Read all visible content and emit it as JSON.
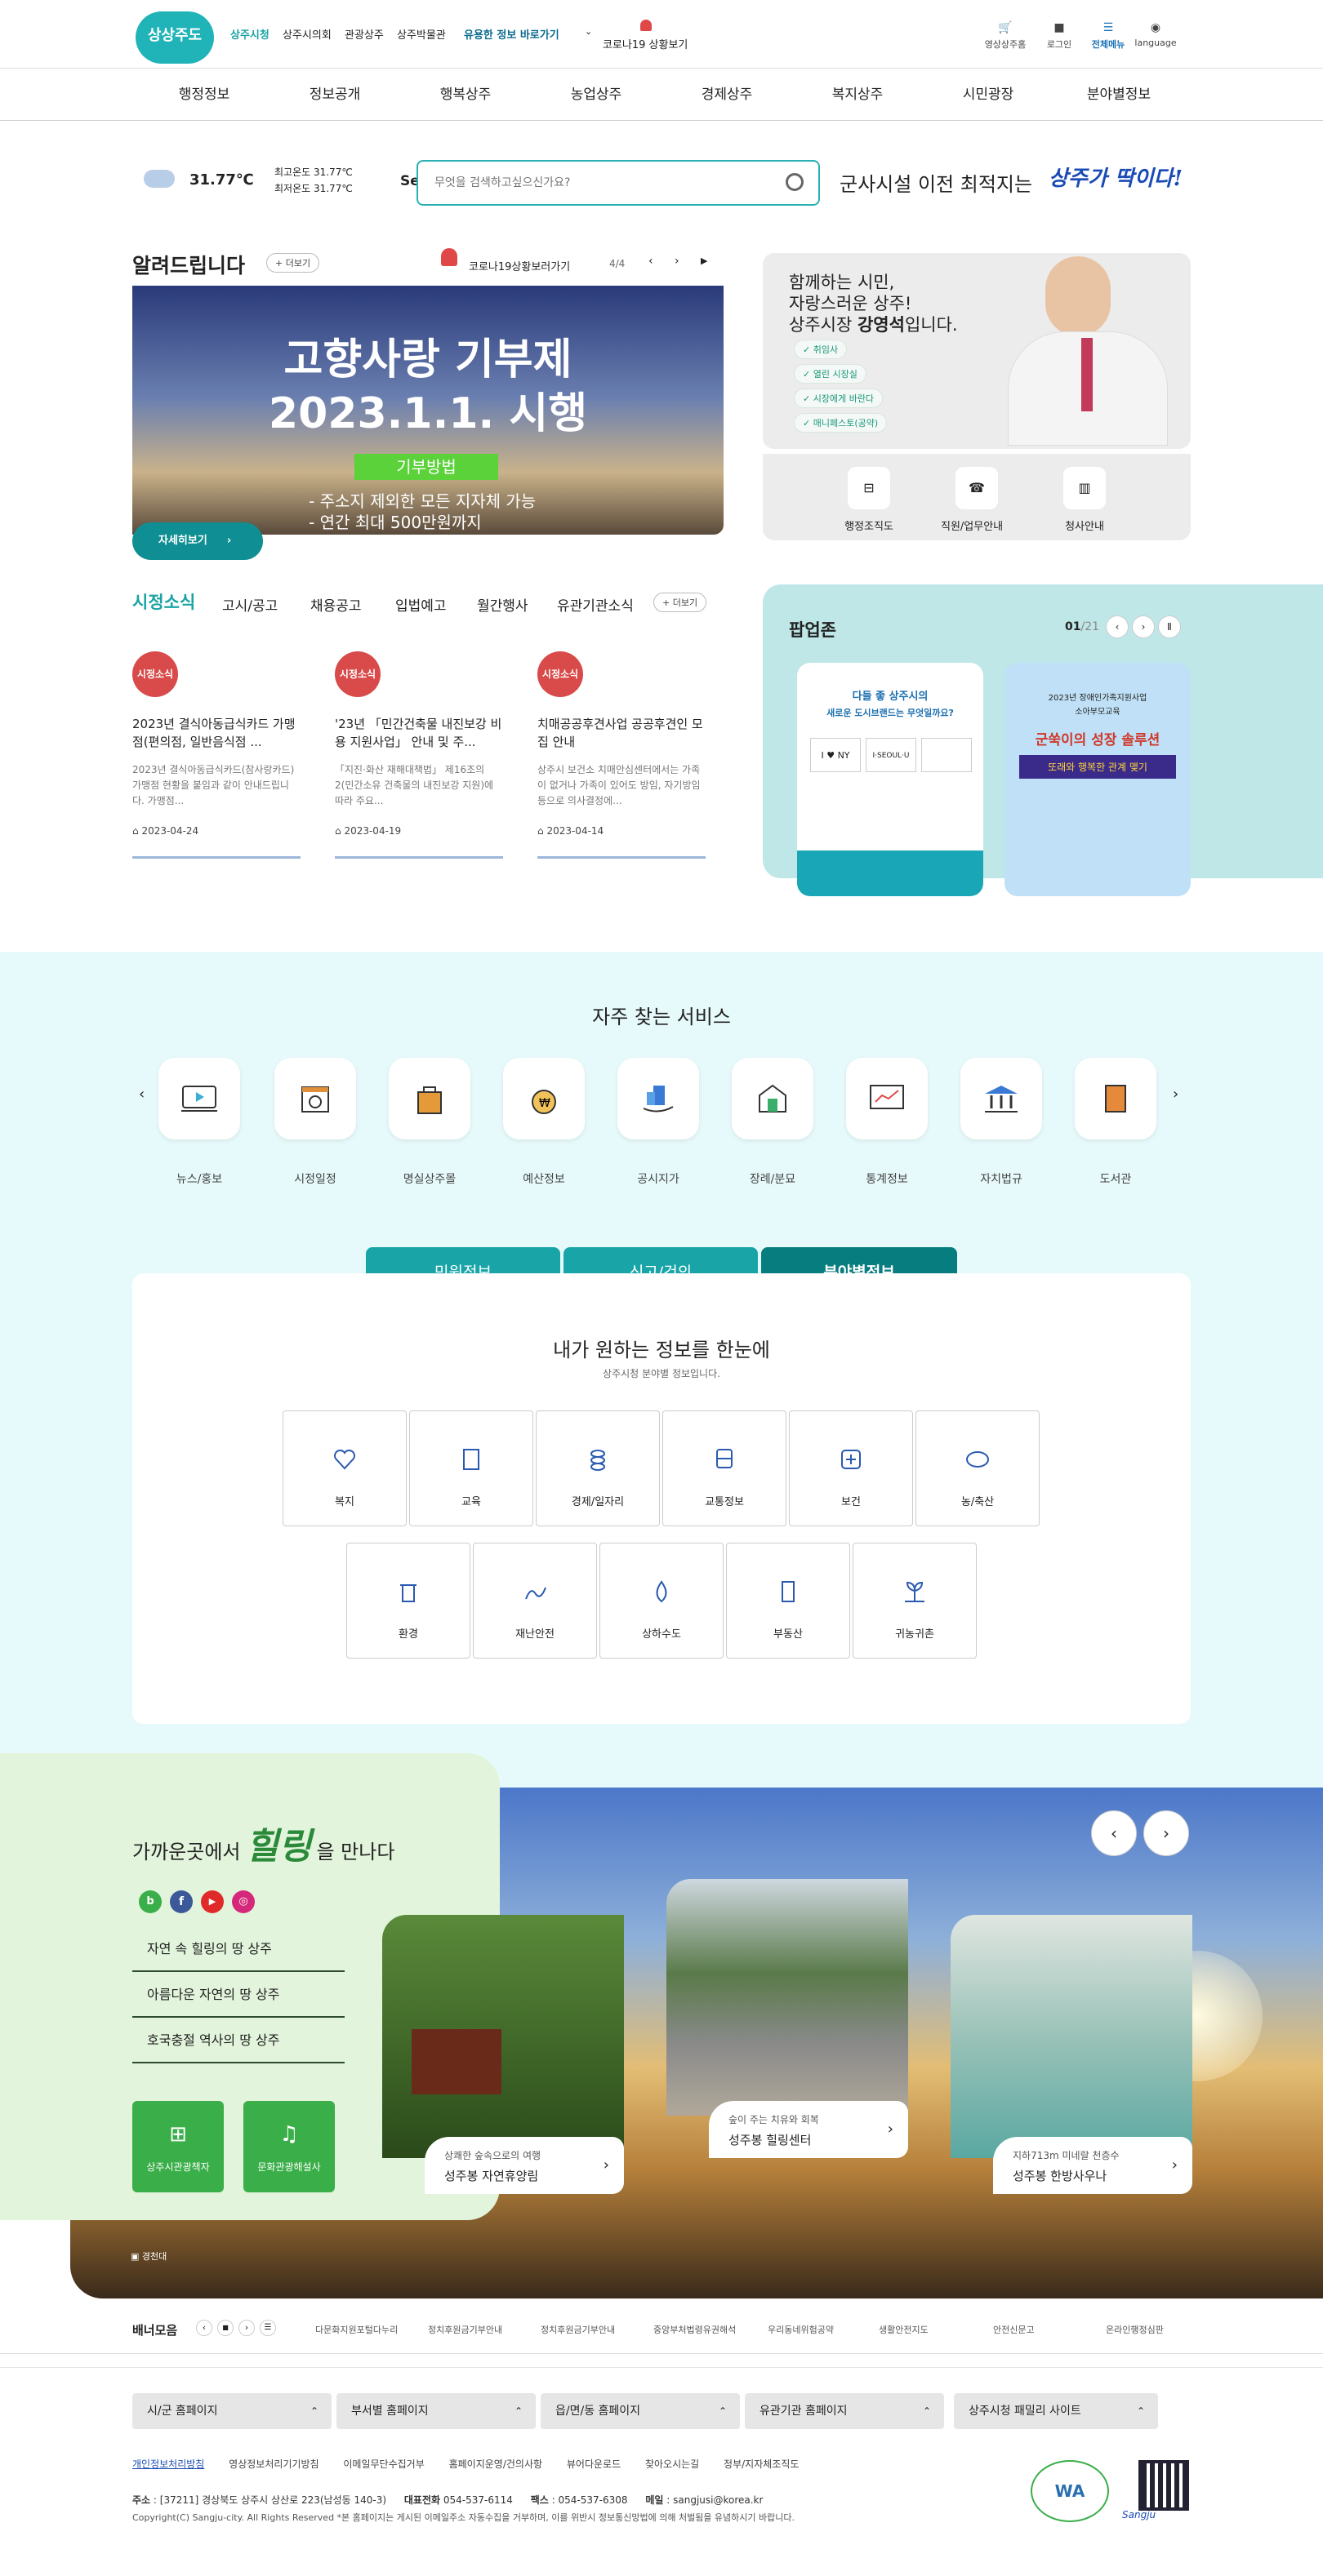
{
  "header": {
    "logo": "상상주도",
    "top_links": [
      "상주시청",
      "상주시의회",
      "관광상주",
      "상주박물관"
    ],
    "info_shortcut": "유용한 정보 바로가기",
    "covid": "코로나19 상황보기",
    "tools": {
      "sitemap": "영상상주홈",
      "login": "로그인",
      "menu": "전체메뉴",
      "lang": "language"
    },
    "gnb": [
      "행정정보",
      "정보공개",
      "행복상주",
      "농업상주",
      "경제상주",
      "복지상주",
      "시민광장",
      "분야별정보"
    ]
  },
  "weather": {
    "temp": "31.77℃",
    "high": "최고온도 31.77℃",
    "low": "최저온도 31.77℃"
  },
  "search": {
    "label": "Search",
    "placeholder": "무엇을 검색하고싶으신가요?"
  },
  "slogan": {
    "text": "군사시설 이전 최적지는",
    "brand": "상주가 딱이다!"
  },
  "notice": {
    "title": "알려드립니다",
    "more": "+ 더보기",
    "covid": "코로나19상황보러가기",
    "page": "4/4",
    "banner": {
      "line1": "고향사랑 기부제",
      "line2": "2023.1.1. 시행",
      "tag": "기부방법",
      "b1": "- 주소지 제외한 모든 지자체 가능",
      "b2": "- 연간 최대 500만원까지",
      "btn": "자세히보기"
    }
  },
  "mayor": {
    "l1": "함께하는 시민,",
    "l2": "자랑스러운 상주!",
    "l3a": "상주시장 ",
    "l3b": "강영석",
    "l3c": "입니다.",
    "tags": [
      "취임사",
      "열린 시장실",
      "시장에게 바란다",
      "매니페스토(공약)"
    ],
    "links": [
      "행정조직도",
      "직원/업무안내",
      "청사안내"
    ]
  },
  "city_news": {
    "title": "시정소식",
    "tabs": [
      "고시/공고",
      "채용공고",
      "입법예고",
      "월간행사",
      "유관기관소식"
    ],
    "more": "+ 더보기",
    "items": [
      {
        "badge": "시정소식",
        "title": "2023년 결식아동급식카드 가맹점(편의점, 일반음식점 ...",
        "desc": "2023년 결식아동급식카드(참사랑카드) 가맹점 현황을 붙임과 같이 안내드립니다. 가맹점...",
        "date": "2023-04-24"
      },
      {
        "badge": "시정소식",
        "title": "'23년 「민간건축물 내진보강 비용 지원사업」 안내 및 주...",
        "desc": "「지진·화산 재해대책법」 제16조의2(민간소유 건축물의 내진보강 지원)에 따라 주요...",
        "date": "2023-04-19"
      },
      {
        "badge": "시정소식",
        "title": "치매공공후견사업 공공후견인 모집 안내",
        "desc": "상주시 보건소 치매안심센터에서는 가족이 없거나 가족이 있어도 방임, 자기방임등으로 의사결정에...",
        "date": "2023-04-14"
      }
    ]
  },
  "popup": {
    "title": "팝업존",
    "cur": "01",
    "total": "/21",
    "p1": {
      "t1": "다들 좋 상주시의",
      "t2": "새로운 도시브랜드는 무엇일까요?",
      "ny": "I ♥ NY",
      "seoul": "I·SEOUL·U"
    },
    "p2": {
      "t1": "2023년 장애인가족지원사업",
      "t2": "소아부모교육",
      "h1": "군쑥이의 성장 솔루션",
      "h2": "또래와 행복한 관계 맺기"
    }
  },
  "services": {
    "title": "자주 찾는 서비스",
    "items": [
      "뉴스/홍보",
      "시정일정",
      "명실상주몰",
      "예산정보",
      "공시지가",
      "장례/분묘",
      "통계정보",
      "자치법규",
      "도서관"
    ]
  },
  "info_tabs": {
    "tabs": [
      "민원정보",
      "신고/건의",
      "분야별정보"
    ],
    "title": "내가 원하는 정보를 한눈에",
    "sub": "상주시청 분야별 정보입니다.",
    "cats": [
      "복지",
      "교육",
      "경제/일자리",
      "교통정보",
      "보건",
      "농/축산",
      "환경",
      "재난안전",
      "상하수도",
      "부동산",
      "귀농귀촌"
    ]
  },
  "healing": {
    "t1": "가까운곳에서",
    "t2": "힐링",
    "t3": "을 만나다",
    "links": [
      "자연 속 힐링의 땅 상주",
      "아름다운 자연의 땅 상주",
      "호국충절 역사의 땅 상주"
    ],
    "btns": [
      "상주시관광책자",
      "문화관광해설사"
    ],
    "cards": [
      {
        "sub": "상쾌한 숲속으로의 여행",
        "name": "성주봉 자연휴양림"
      },
      {
        "sub": "숲이 주는 치유와 회복",
        "name": "성주봉 힐링센터"
      },
      {
        "sub": "지하713m 미네랄 천층수",
        "name": "성주봉 한방사우나"
      }
    ],
    "credit": "경천대"
  },
  "banner_zone": {
    "title": "배너모음",
    "items": [
      "다문화지원포털다누리",
      "정치후원금기부안내",
      "정치후원금기부안내",
      "중앙부처법령유권해석",
      "우리동네위험공약",
      "생활안전지도",
      "안전신문고",
      "온라인행정심판"
    ]
  },
  "footer": {
    "selects": [
      "시/군 홈페이지",
      "부서별 홈페이지",
      "읍/면/동 홈페이지",
      "유관기관 홈페이지",
      "상주시청 패밀리 사이트"
    ],
    "links": [
      "개인정보처리방침",
      "영상정보처리기기방침",
      "이메일무단수집거부",
      "홈페이지운영/건의사항",
      "뷰어다운로드",
      "찾아오시는길",
      "정부/지자체조직도"
    ],
    "addr_label": "주소",
    "addr": ": [37211] 경상북도 상주시 상산로 223(남성동 140-3)",
    "tel_label": "대표전화",
    "tel": "054-537-6114",
    "fax_label": "팩스",
    "fax": ": 054-537-6308",
    "mail_label": "메일",
    "mail": ": sangjusi@korea.kr",
    "copy": "Copyright(C) Sangju-city. All Rights Reserved *본 홈페이지는 게시된 이메일주소 자동수집을 거부하며, 이를 위반시 정보통신망법에 의해 처벌됨을 유념하시기 바랍니다.",
    "wa": "WA",
    "sangju": "Sangju"
  },
  "colors": {
    "teal": "#1aa3a5",
    "teal_dark": "#087d80",
    "mint_bg": "#e7fafb",
    "green": "#3aae48",
    "navy": "#0b2e6b"
  }
}
